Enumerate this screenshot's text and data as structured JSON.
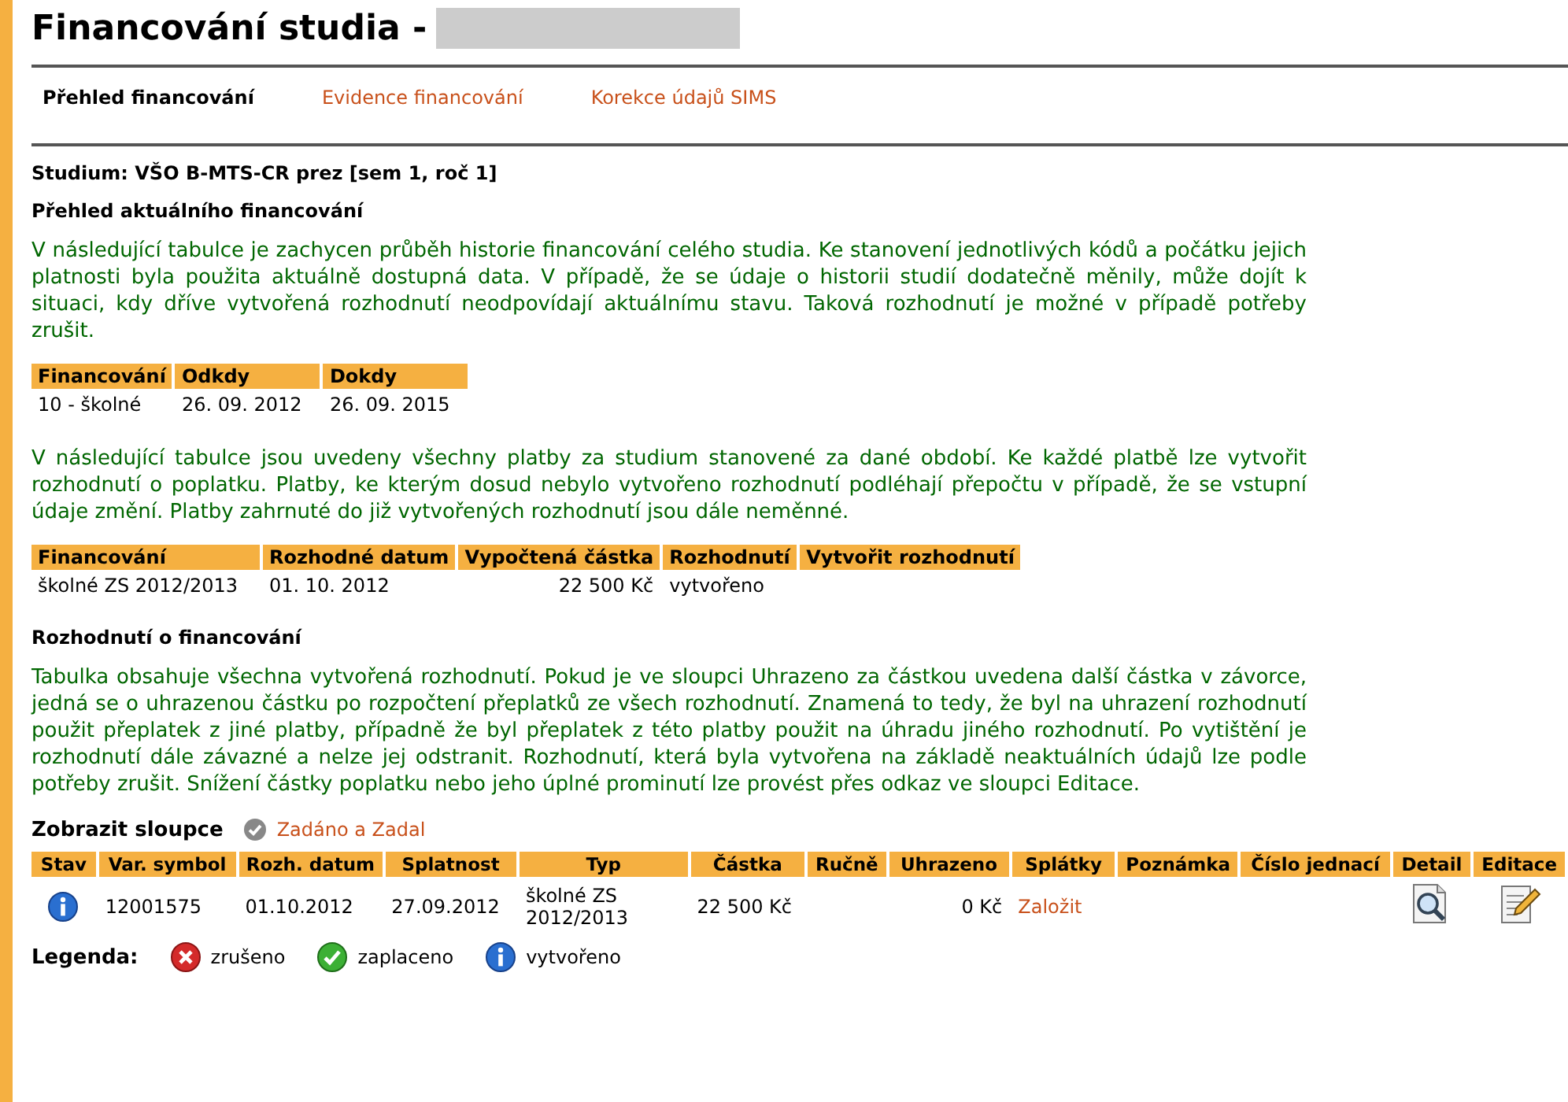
{
  "title": "Financování studia -",
  "tabs": [
    {
      "label": "Přehled financování",
      "selected": true
    },
    {
      "label": "Evidence financování",
      "selected": false
    },
    {
      "label": "Korekce údajů SIMS",
      "selected": false
    }
  ],
  "study": "Studium: VŠO B-MTS-CR prez [sem 1, roč 1]",
  "overview": {
    "heading": "Přehled aktuálního financování",
    "text": "V následující tabulce je zachycen průběh historie financování celého studia. Ke stanovení jednotlivých kódů a počátku jejich platnosti byla použita aktuálně dostupná data. V případě, že se údaje o historii studií dodatečně měnily, může dojít k situaci, kdy dříve vytvořená rozhodnutí neodpovídají aktuálnímu stavu. Taková rozhodnutí je možné v případě potřeby zrušit.",
    "table": {
      "columns": [
        "Financování",
        "Odkdy",
        "Dokdy"
      ],
      "rows": [
        [
          "10 - školné",
          "26. 09. 2012",
          "26. 09. 2015"
        ]
      ]
    }
  },
  "payments": {
    "text": "V následující tabulce jsou uvedeny všechny platby za studium stanovené za dané období. Ke každé platbě lze vytvořit rozhodnutí o poplatku. Platby, ke kterým dosud nebylo vytvořeno rozhodnutí podléhají přepočtu v případě, že se vstupní údaje změní. Platby zahrnuté do již vytvořených rozhodnutí jsou dále neměnné.",
    "table": {
      "columns": [
        "Financování",
        "Rozhodné datum",
        "Vypočtená částka",
        "Rozhodnutí",
        "Vytvořit rozhodnutí"
      ],
      "rows": [
        {
          "financing": "školné ZS 2012/2013",
          "date": "01. 10. 2012",
          "amount": "22 500 Kč",
          "decision": "vytvořeno"
        }
      ]
    }
  },
  "decisions": {
    "heading": "Rozhodnutí o financování",
    "text": "Tabulka obsahuje všechna vytvořená rozhodnutí. Pokud je ve sloupci Uhrazeno za částkou uvedena další částka v závorce, jedná se o uhrazenou částku po rozpočtení přeplatků ze všech rozhodnutí. Znamená to tedy, že byl na uhrazení rozhodnutí použit přeplatek z jiné platby, případně že byl přeplatek z této platby použit na úhradu jiného rozhodnutí. Po vytištění je rozhodnutí dále závazné a nelze jej odstranit. Rozhodnutí, která byla vytvořena na základě neaktuálních údajů lze podle potřeby zrušit. Snížení částky poplatku nebo jeho úplné prominutí lze provést přes odkaz ve sloupci Editace.",
    "show_columns_label": "Zobrazit sloupce",
    "show_columns_link": "Zadáno a Zadal",
    "table": {
      "columns": [
        "Stav",
        "Var. symbol",
        "Rozh. datum",
        "Splatnost",
        "Typ",
        "Částka",
        "Ručně",
        "Uhrazeno",
        "Splátky",
        "Poznámka",
        "Číslo jednací",
        "Detail",
        "Editace"
      ],
      "rows": [
        {
          "kind": "info",
          "var_symbol": "12001575",
          "decision_date": "01.10.2012",
          "due_date": "27.09.2012",
          "type": "školné ZS 2012/2013",
          "amount": "22 500 Kč",
          "paid": "0 Kč",
          "installments": "Založit"
        }
      ]
    }
  },
  "legend": {
    "label": "Legenda:",
    "items": [
      {
        "kind": "cancelled",
        "label": "zrušeno"
      },
      {
        "kind": "paid",
        "label": "zaplaceno"
      },
      {
        "kind": "info",
        "label": "vytvořeno"
      }
    ]
  }
}
